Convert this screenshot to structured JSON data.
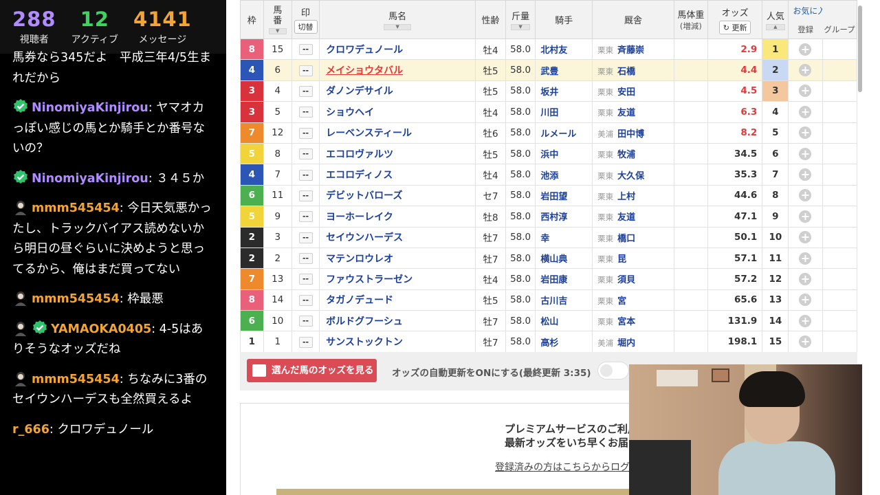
{
  "stats": [
    {
      "value": "288",
      "label": "視聴者",
      "color": "#b18cff"
    },
    {
      "value": "12",
      "label": "アクティブ",
      "color": "#3ed35f"
    },
    {
      "value": "4141",
      "label": "メッセージ",
      "color": "#f2a534"
    }
  ],
  "chat": [
    {
      "user": "",
      "badge": false,
      "avatar": false,
      "user_color": "#fff",
      "text": "馬券なら345だよ　平成三年4/5生まれだから"
    },
    {
      "user": "NinomiyaKinjirou",
      "badge": true,
      "avatar": false,
      "user_color": "#b18cff",
      "text": ": ヤマオカっぽい感じの馬とか騎手とか番号ないの？"
    },
    {
      "user": "NinomiyaKinjirou",
      "badge": true,
      "avatar": false,
      "user_color": "#b18cff",
      "text": ": ３４５か"
    },
    {
      "user": "mmm545454",
      "badge": false,
      "avatar": true,
      "user_color": "#f2a534",
      "text": ": 今日天気悪かったし、トラックバイアス読めないから明日の昼ぐらいに決めようと思ってるから、俺はまだ買ってない"
    },
    {
      "user": "mmm545454",
      "badge": false,
      "avatar": true,
      "user_color": "#f2a534",
      "text": ": 枠最悪"
    },
    {
      "user": "YAMAOKA0405",
      "badge": true,
      "avatar": true,
      "user_color": "#f2a534",
      "text": ": 4-5はありそうなオッズだね"
    },
    {
      "user": "mmm545454",
      "badge": false,
      "avatar": true,
      "user_color": "#f2a534",
      "text": ": ちなみに3番のセイウンハーデスも全然買えるよ"
    },
    {
      "user": "r_666",
      "badge": false,
      "avatar": false,
      "user_color": "#f2a534",
      "text": ": クロワデュノール"
    }
  ],
  "table": {
    "headers": {
      "waku": "枠",
      "umaban": "馬番",
      "mark": "印",
      "mark_sub": "切替",
      "name": "馬名",
      "sex_age": "性齢",
      "weight": "斤量",
      "jockey": "騎手",
      "stable": "厩舎",
      "body_weight": "馬体重",
      "body_weight_sub": "(増減)",
      "odds": "オッズ",
      "refresh": "更新",
      "popularity": "人気",
      "favorites": "お気に入り馬",
      "fav_register": "登録",
      "fav_group": "グループ"
    },
    "waku_colors": {
      "1": "#ffffff",
      "2": "#2b2b2b",
      "3": "#d8323c",
      "4": "#2c56b5",
      "5": "#f0d43a",
      "6": "#4caf50",
      "7": "#ef8a2c",
      "8": "#e8607a"
    },
    "rows": [
      {
        "waku": "8",
        "umaban": "15",
        "mark": "--",
        "name": "クロワデュノール",
        "sex_age": "牡4",
        "weight": "58.0",
        "jockey": "北村友",
        "region": "栗東",
        "trainer": "斉藤崇",
        "odds": "2.9",
        "pop": "1"
      },
      {
        "waku": "4",
        "umaban": "6",
        "mark": "--",
        "name": "メイショウタバル",
        "sex_age": "牡5",
        "weight": "58.0",
        "jockey": "武豊",
        "region": "栗東",
        "trainer": "石橋",
        "odds": "4.4",
        "pop": "2"
      },
      {
        "waku": "3",
        "umaban": "4",
        "mark": "--",
        "name": "ダノンデサイル",
        "sex_age": "牡5",
        "weight": "58.0",
        "jockey": "坂井",
        "region": "栗東",
        "trainer": "安田",
        "odds": "4.5",
        "pop": "3"
      },
      {
        "waku": "3",
        "umaban": "5",
        "mark": "--",
        "name": "ショウヘイ",
        "sex_age": "牡4",
        "weight": "58.0",
        "jockey": "川田",
        "region": "栗東",
        "trainer": "友道",
        "odds": "6.3",
        "pop": "4"
      },
      {
        "waku": "7",
        "umaban": "12",
        "mark": "--",
        "name": "レーベンスティール",
        "sex_age": "牡6",
        "weight": "58.0",
        "jockey": "ルメール",
        "region": "美浦",
        "trainer": "田中博",
        "odds": "8.2",
        "pop": "5"
      },
      {
        "waku": "5",
        "umaban": "8",
        "mark": "--",
        "name": "エコロヴァルツ",
        "sex_age": "牡5",
        "weight": "58.0",
        "jockey": "浜中",
        "region": "栗東",
        "trainer": "牧浦",
        "odds": "34.5",
        "pop": "6"
      },
      {
        "waku": "4",
        "umaban": "7",
        "mark": "--",
        "name": "エコロディノス",
        "sex_age": "牡4",
        "weight": "58.0",
        "jockey": "池添",
        "region": "栗東",
        "trainer": "大久保",
        "odds": "35.3",
        "pop": "7"
      },
      {
        "waku": "6",
        "umaban": "11",
        "mark": "--",
        "name": "デビットバローズ",
        "sex_age": "セ7",
        "weight": "58.0",
        "jockey": "岩田望",
        "region": "栗東",
        "trainer": "上村",
        "odds": "44.6",
        "pop": "8"
      },
      {
        "waku": "5",
        "umaban": "9",
        "mark": "--",
        "name": "ヨーホーレイク",
        "sex_age": "牡8",
        "weight": "58.0",
        "jockey": "西村淳",
        "region": "栗東",
        "trainer": "友道",
        "odds": "47.1",
        "pop": "9"
      },
      {
        "waku": "2",
        "umaban": "3",
        "mark": "--",
        "name": "セイウンハーデス",
        "sex_age": "牡7",
        "weight": "58.0",
        "jockey": "幸",
        "region": "栗東",
        "trainer": "橋口",
        "odds": "50.1",
        "pop": "10"
      },
      {
        "waku": "2",
        "umaban": "2",
        "mark": "--",
        "name": "マテンロウレオ",
        "sex_age": "牡7",
        "weight": "58.0",
        "jockey": "横山典",
        "region": "栗東",
        "trainer": "昆",
        "odds": "57.1",
        "pop": "11"
      },
      {
        "waku": "7",
        "umaban": "13",
        "mark": "--",
        "name": "ファウストラーゼン",
        "sex_age": "牡4",
        "weight": "58.0",
        "jockey": "岩田康",
        "region": "栗東",
        "trainer": "須貝",
        "odds": "57.2",
        "pop": "12"
      },
      {
        "waku": "8",
        "umaban": "14",
        "mark": "--",
        "name": "タガノデュード",
        "sex_age": "牡5",
        "weight": "58.0",
        "jockey": "古川吉",
        "region": "栗東",
        "trainer": "宮",
        "odds": "65.6",
        "pop": "13"
      },
      {
        "waku": "6",
        "umaban": "10",
        "mark": "--",
        "name": "ボルドグフーシュ",
        "sex_age": "牡7",
        "weight": "58.0",
        "jockey": "松山",
        "region": "栗東",
        "trainer": "宮本",
        "odds": "131.9",
        "pop": "14"
      },
      {
        "waku": "1",
        "umaban": "1",
        "mark": "--",
        "name": "サンストックトン",
        "sex_age": "牡7",
        "weight": "58.0",
        "jockey": "高杉",
        "region": "美浦",
        "trainer": "堀内",
        "odds": "198.1",
        "pop": "15"
      }
    ]
  },
  "bottombar": {
    "view_odds_label": "選んだ馬のオッズを見る",
    "auto_update_label": "オッズの自動更新をONにする(最終更新 3:35)"
  },
  "premium": {
    "line1": "プレミアムサービスのご利用",
    "line2": "最新オッズをいち早くお届け",
    "login_text": "登録済みの方はこちらからログ"
  }
}
